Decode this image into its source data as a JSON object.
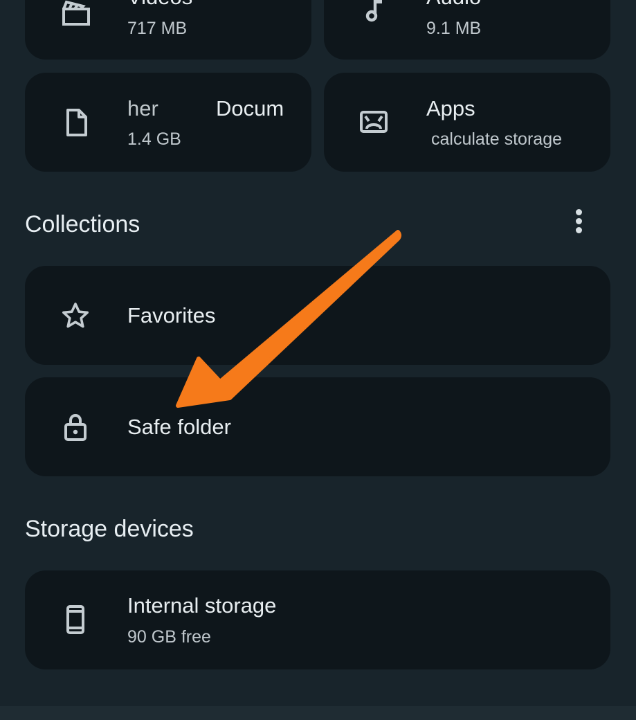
{
  "categories": [
    {
      "id": "videos",
      "label": "Videos",
      "size": "717 MB",
      "icon": "movie-icon"
    },
    {
      "id": "audio",
      "label": "Audio",
      "size": "9.1 MB",
      "icon": "music-note-icon"
    },
    {
      "id": "documents",
      "label_left": "her",
      "label_right": "Docum",
      "size": "1.4 GB",
      "icon": "document-icon"
    },
    {
      "id": "apps",
      "label": "Apps",
      "size": "calculate storage",
      "icon": "android-icon"
    }
  ],
  "collections": {
    "title": "Collections",
    "menu_icon": "more-vert-icon",
    "items": [
      {
        "label": "Favorites",
        "icon": "star-outline-icon"
      },
      {
        "label": "Safe folder",
        "icon": "lock-icon"
      }
    ]
  },
  "storage_devices": {
    "title": "Storage devices",
    "items": [
      {
        "label": "Internal storage",
        "detail": "90 GB free",
        "icon": "phone-icon"
      }
    ]
  },
  "annotation": {
    "arrow_icon": "arrow-annotation-icon",
    "arrow_color": "#f67a1a"
  },
  "colors": {
    "background": "#18242b",
    "card": "#0e161b",
    "text_primary": "#e8eef1",
    "text_secondary": "#c0c8cd"
  }
}
